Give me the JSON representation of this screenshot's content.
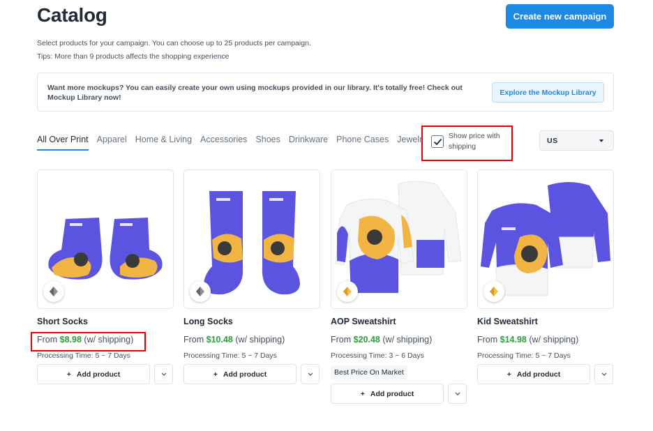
{
  "header": {
    "title": "Catalog",
    "create_button": "Create new campaign",
    "subtitle": "Select products for your campaign. You can choose up to 25 products per campaign.",
    "tips": "Tips: More than 9 products affects the shopping experience"
  },
  "banner": {
    "text": "Want more mockups? You can easily create your own using mockups provided in our library. It's totally free! Check out Mockup Library now!",
    "button": "Explore the Mockup Library"
  },
  "tabs": [
    "All Over Print",
    "Apparel",
    "Home & Living",
    "Accessories",
    "Shoes",
    "Drinkware",
    "Phone Cases",
    "Jewelry"
  ],
  "filters": {
    "show_price_label": "Show price with shipping",
    "show_price_checked": true,
    "country": "US"
  },
  "products": [
    {
      "name": "Short Socks",
      "from": "From",
      "price": "$8.98",
      "shipping": "(w/ shipping)",
      "processing": "Processing Time: 5 ~ 7 Days",
      "badge": "",
      "add_label": "Add product"
    },
    {
      "name": "Long Socks",
      "from": "From",
      "price": "$10.48",
      "shipping": "(w/ shipping)",
      "processing": "Processing Time: 5 ~ 7 Days",
      "badge": "",
      "add_label": "Add product"
    },
    {
      "name": "AOP Sweatshirt",
      "from": "From",
      "price": "$20.48",
      "shipping": "(w/ shipping)",
      "processing": "Processing Time: 3 ~ 6 Days",
      "badge": "Best Price On Market",
      "add_label": "Add product"
    },
    {
      "name": "Kid Sweatshirt",
      "from": "From",
      "price": "$14.98",
      "shipping": "(w/ shipping)",
      "processing": "Processing Time: 5 ~ 7 Days",
      "badge": "",
      "add_label": "Add product"
    }
  ],
  "colors": {
    "accent": "#1e88e5",
    "price_green": "#2e9d3f",
    "highlight_red": "#e00000",
    "product_purple": "#5b54e0",
    "product_gold": "#f2b544"
  }
}
